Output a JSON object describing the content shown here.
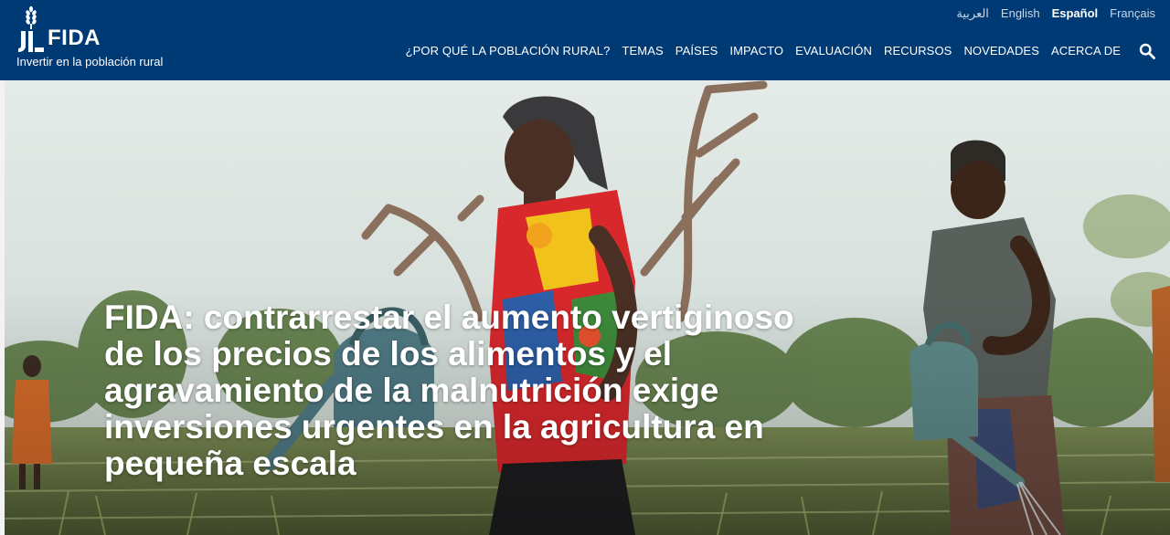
{
  "brand": {
    "logo_text": "FIDA",
    "tagline": "Invertir en la población rural"
  },
  "languages": [
    {
      "label": "العربية",
      "active": false
    },
    {
      "label": "English",
      "active": false
    },
    {
      "label": "Español",
      "active": true
    },
    {
      "label": "Français",
      "active": false
    }
  ],
  "nav": {
    "items": [
      {
        "label": "¿POR QUÉ LA POBLACIÓN RURAL?"
      },
      {
        "label": "TEMAS"
      },
      {
        "label": "PAÍSES"
      },
      {
        "label": "IMPACTO"
      },
      {
        "label": "EVALUACIÓN"
      },
      {
        "label": "RECURSOS"
      },
      {
        "label": "NOVEDADES"
      },
      {
        "label": "ACERCA DE"
      }
    ],
    "search_icon": "search-icon"
  },
  "hero": {
    "headline": "FIDA: contrarrestar el aumento vertiginoso de los precios de los alimentos y el agravamiento de la malnutrición exige inversiones urgentes en la agricultura en pequeña escala"
  },
  "colors": {
    "header_bg": "#003a75",
    "text_on_header": "#ffffff",
    "inactive_lang": "#c9d6e6"
  }
}
